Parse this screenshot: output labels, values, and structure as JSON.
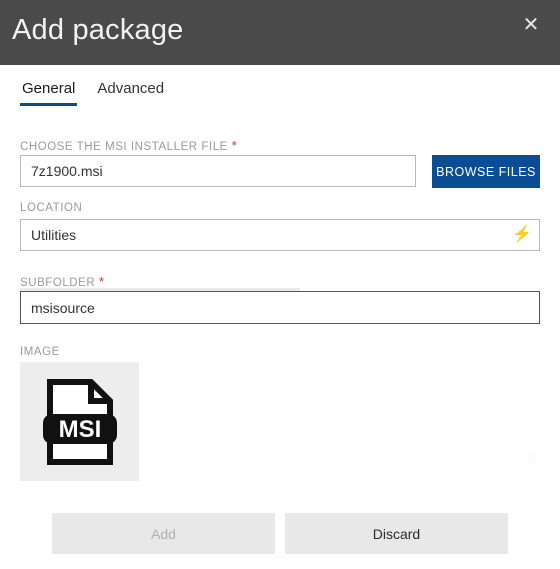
{
  "window": {
    "title": "Add package",
    "close_icon": "close-icon",
    "header_color": "#4a4a4a"
  },
  "tabs": [
    {
      "label": "General",
      "active": true
    },
    {
      "label": "Advanced",
      "active": false
    }
  ],
  "accent_color": "#0a4d8c",
  "fields": {
    "installer": {
      "label": "CHOOSE THE MSI INSTALLER FILE",
      "required_mark": "*",
      "value": "7z1900.msi",
      "placeholder": ""
    },
    "location": {
      "label": "LOCATION",
      "required_mark": "",
      "value": "Utilities",
      "placeholder": "",
      "action_icon": "lightning-bolt-icon",
      "action_glyph": "⚡"
    },
    "subfolder": {
      "label": "SUBFOLDER",
      "required_mark": "*",
      "value": "msisource",
      "placeholder": "",
      "focused": true
    },
    "image": {
      "label": "IMAGE",
      "thumbnail_icon": "msi-file-icon",
      "thumbnail_text": "MSI"
    }
  },
  "buttons": {
    "browse": {
      "label": "BROWSE FILES",
      "color": "#0b4d94"
    },
    "add": {
      "label": "Add",
      "enabled": false
    },
    "discard": {
      "label": "Discard",
      "enabled": true
    }
  }
}
